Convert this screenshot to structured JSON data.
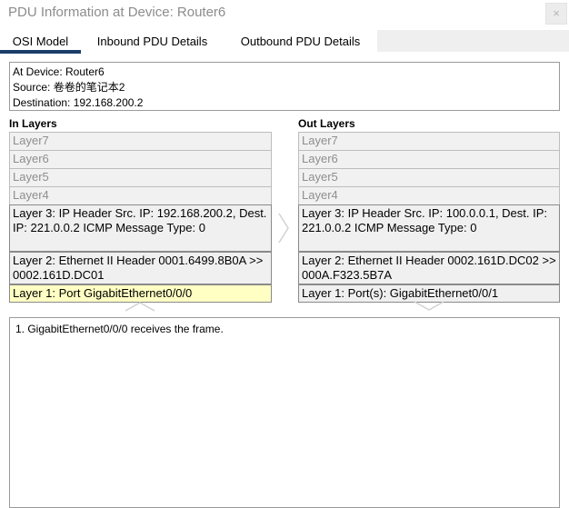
{
  "window": {
    "title": "PDU Information at Device: Router6",
    "close_label": "×"
  },
  "tabs": [
    {
      "label": "OSI Model",
      "active": true
    },
    {
      "label": "Inbound PDU Details",
      "active": false
    },
    {
      "label": "Outbound PDU Details",
      "active": false
    }
  ],
  "info": {
    "device": "At Device: Router6",
    "source": "Source: 卷卷的笔记本2",
    "destination": "Destination: 192.168.200.2"
  },
  "in_layers": {
    "title": "In Layers",
    "layers": [
      "Layer7",
      "Layer6",
      "Layer5",
      "Layer4",
      "Layer 3: IP Header Src. IP: 192.168.200.2, Dest. IP: 221.0.0.2 ICMP Message Type: 0",
      "Layer 2: Ethernet II Header 0001.6499.8B0A >> 0002.161D.DC01",
      "Layer 1: Port GigabitEthernet0/0/0"
    ]
  },
  "out_layers": {
    "title": "Out Layers",
    "layers": [
      "Layer7",
      "Layer6",
      "Layer5",
      "Layer4",
      "Layer 3: IP Header Src. IP: 100.0.0.1, Dest. IP: 221.0.0.2 ICMP Message Type: 0",
      "Layer 2: Ethernet II Header 0002.161D.DC02 >> 000A.F323.5B7A",
      "Layer 1: Port(s): GigabitEthernet0/0/1"
    ]
  },
  "details": {
    "text": "1. GigabitEthernet0/0/0 receives the frame."
  },
  "colors": {
    "tab_underline": "#1b3e6a",
    "current_layer": "#ffffc4"
  },
  "icons": {
    "close": "close-icon",
    "mid_arrow": "chevron-right-icon",
    "up_arrow": "chevron-up-icon",
    "down_arrow": "chevron-down-icon"
  }
}
